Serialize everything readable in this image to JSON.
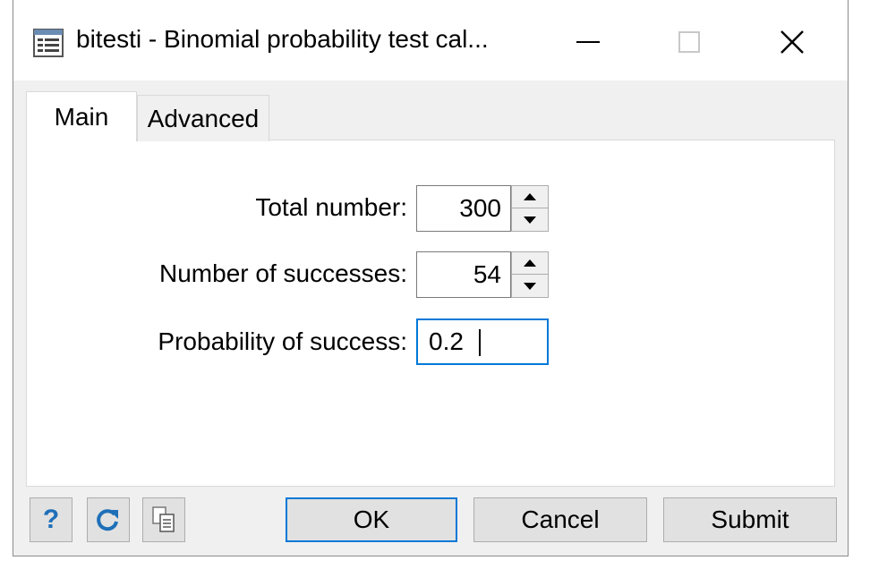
{
  "window": {
    "title": "bitesti - Binomial probability test cal...",
    "icon": "dialog-list-icon",
    "controls": [
      "minimize-icon",
      "maximize-icon",
      "close-icon"
    ]
  },
  "tabs": [
    {
      "label": "Main",
      "active": true
    },
    {
      "label": "Advanced",
      "active": false
    }
  ],
  "form": {
    "total": {
      "label": "Total number:",
      "value": "300"
    },
    "successes": {
      "label": "Number of successes:",
      "value": "54"
    },
    "probability": {
      "label": "Probability of success:",
      "value": "0.2"
    }
  },
  "footer": {
    "help_label": "?",
    "ok_label": "OK",
    "cancel_label": "Cancel",
    "submit_label": "Submit",
    "icons": [
      "help-icon",
      "reset-icon",
      "copy-command-icon"
    ]
  },
  "colors": {
    "focus": "#0078d7",
    "icon_blue": "#1e6fb8"
  }
}
